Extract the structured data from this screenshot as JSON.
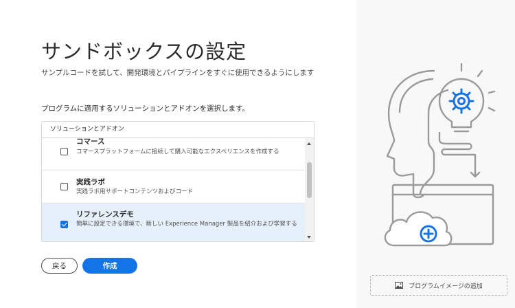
{
  "page": {
    "title": "サンドボックスの設定",
    "subtitle": "サンプルコードを試して、開発環境とパイプラインをすぐに使用できるようにします",
    "instruction": "プログラムに適用するソリューションとアドオンを選択します。"
  },
  "solutions": {
    "header": "ソリューションとアドオン",
    "items": [
      {
        "name": "コマース",
        "description": "コマースプラットフォームに接続して購入可能なエクスペリエンスを作成する",
        "checked": false
      },
      {
        "name": "実践ラボ",
        "description": "実践ラボ用サポートコンテンツおよびコード",
        "checked": false
      },
      {
        "name": "リファレンスデモ",
        "description": "簡単に設定できる環境で、新しい Experience Manager 製品を紹介および学習する",
        "checked": true
      }
    ]
  },
  "buttons": {
    "back": "戻る",
    "create": "作成"
  },
  "sidebar": {
    "add_image_label": "プログラムイメージの追加",
    "illustration_icons": [
      "gear-icon",
      "plus-icon",
      "cloud-icon",
      "lightbulb-icon"
    ]
  },
  "colors": {
    "accent": "#1473e6",
    "selected_row": "#e5f0fa",
    "illustration_stroke": "#9a9a9a"
  }
}
